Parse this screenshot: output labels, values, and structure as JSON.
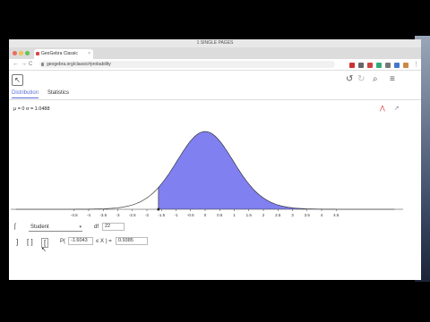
{
  "os_bar": {
    "title": "1 SINGLE PAGES"
  },
  "browser": {
    "tab_title": "GeoGebra Classic",
    "tab_close": "×",
    "url": "geogebra.org/classic#probability",
    "nav": {
      "back": "←",
      "forward": "→",
      "reload": "C"
    }
  },
  "app_toolbar": {
    "move_tool": "↖",
    "undo": "↺",
    "redo": "↻",
    "search": "⌕",
    "menu": "≡"
  },
  "app_tabs": [
    {
      "label": "Distribution",
      "active": true
    },
    {
      "label": "Statistics",
      "active": false
    }
  ],
  "params_text": "μ = 0  σ = 1.0488",
  "graph_icons": {
    "style": "⋀",
    "export": "↗"
  },
  "plot": {
    "x_ticks": [
      "-4.5",
      "-4",
      "-3.5",
      "-3",
      "-2.5",
      "-2",
      "-1.5",
      "-1",
      "-0.5",
      "0",
      "0.5",
      "1",
      "1.5",
      "2",
      "2.5",
      "3",
      "3.5",
      "4",
      "4.5"
    ],
    "fill_color": "#8080f0",
    "distribution": "Student",
    "df": 22,
    "lower_bound": -1.6043
  },
  "controls": {
    "distribution_label": "Student",
    "df_label": "df",
    "df_value": "22",
    "prob_prefix": "P(",
    "prob_x": "-1.6043",
    "prob_op": "≤ X  ) =",
    "prob_result": "0.9385",
    "bracket_left": "]",
    "bracket_mid": "[ ]",
    "bracket_right": "["
  }
}
